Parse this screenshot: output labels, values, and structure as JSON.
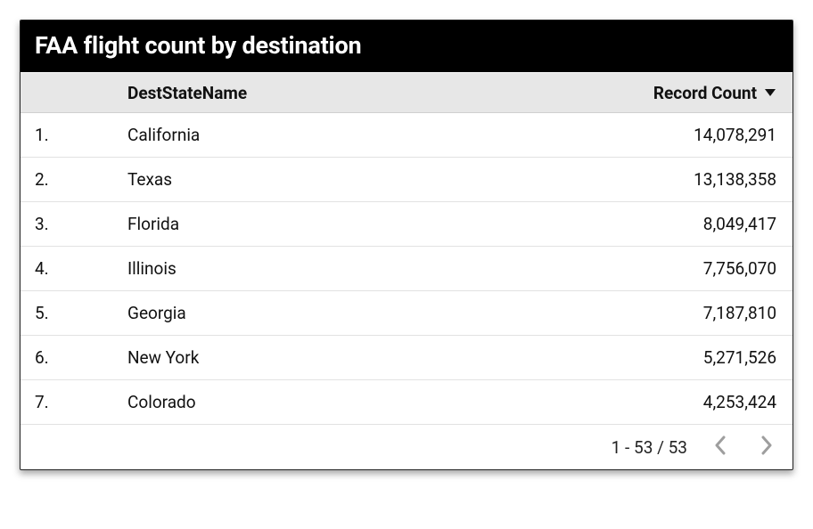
{
  "chart_data": {
    "type": "table",
    "title": "FAA flight count by destination",
    "columns": [
      "DestStateName",
      "Record Count"
    ],
    "sort": {
      "column": "Record Count",
      "direction": "desc"
    },
    "total_rows": 53,
    "rows_visible": [
      {
        "rank": "1.",
        "DestStateName": "California",
        "RecordCount": "14,078,291"
      },
      {
        "rank": "2.",
        "DestStateName": "Texas",
        "RecordCount": "13,138,358"
      },
      {
        "rank": "3.",
        "DestStateName": "Florida",
        "RecordCount": "8,049,417"
      },
      {
        "rank": "4.",
        "DestStateName": "Illinois",
        "RecordCount": "7,756,070"
      },
      {
        "rank": "5.",
        "DestStateName": "Georgia",
        "RecordCount": "7,187,810"
      },
      {
        "rank": "6.",
        "DestStateName": "New York",
        "RecordCount": "5,271,526"
      },
      {
        "rank": "7.",
        "DestStateName": "Colorado",
        "RecordCount": "4,253,424"
      }
    ]
  },
  "header": {
    "title": "FAA flight count by destination"
  },
  "columns": {
    "index_label": "",
    "name_label": "DestStateName",
    "count_label": "Record Count"
  },
  "rows": [
    {
      "index": "1.",
      "name": "California",
      "count": "14,078,291"
    },
    {
      "index": "2.",
      "name": "Texas",
      "count": "13,138,358"
    },
    {
      "index": "3.",
      "name": "Florida",
      "count": "8,049,417"
    },
    {
      "index": "4.",
      "name": "Illinois",
      "count": "7,756,070"
    },
    {
      "index": "5.",
      "name": "Georgia",
      "count": "7,187,810"
    },
    {
      "index": "6.",
      "name": "New York",
      "count": "5,271,526"
    },
    {
      "index": "7.",
      "name": "Colorado",
      "count": "4,253,424"
    }
  ],
  "footer": {
    "range": "1 - 53 / 53"
  }
}
